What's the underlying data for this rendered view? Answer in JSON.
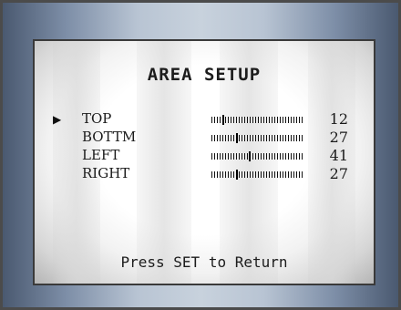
{
  "title": "AREA SETUP",
  "rows": [
    {
      "label": "TOP",
      "value": "12",
      "level": 0.12,
      "selected": true
    },
    {
      "label": "BOTTM",
      "value": "27",
      "level": 0.27,
      "selected": false
    },
    {
      "label": "LEFT",
      "value": "41",
      "level": 0.41,
      "selected": false
    },
    {
      "label": "RIGHT",
      "value": "27",
      "level": 0.27,
      "selected": false
    }
  ],
  "cursor_symbol": "▶",
  "footer": "Press SET to Return"
}
